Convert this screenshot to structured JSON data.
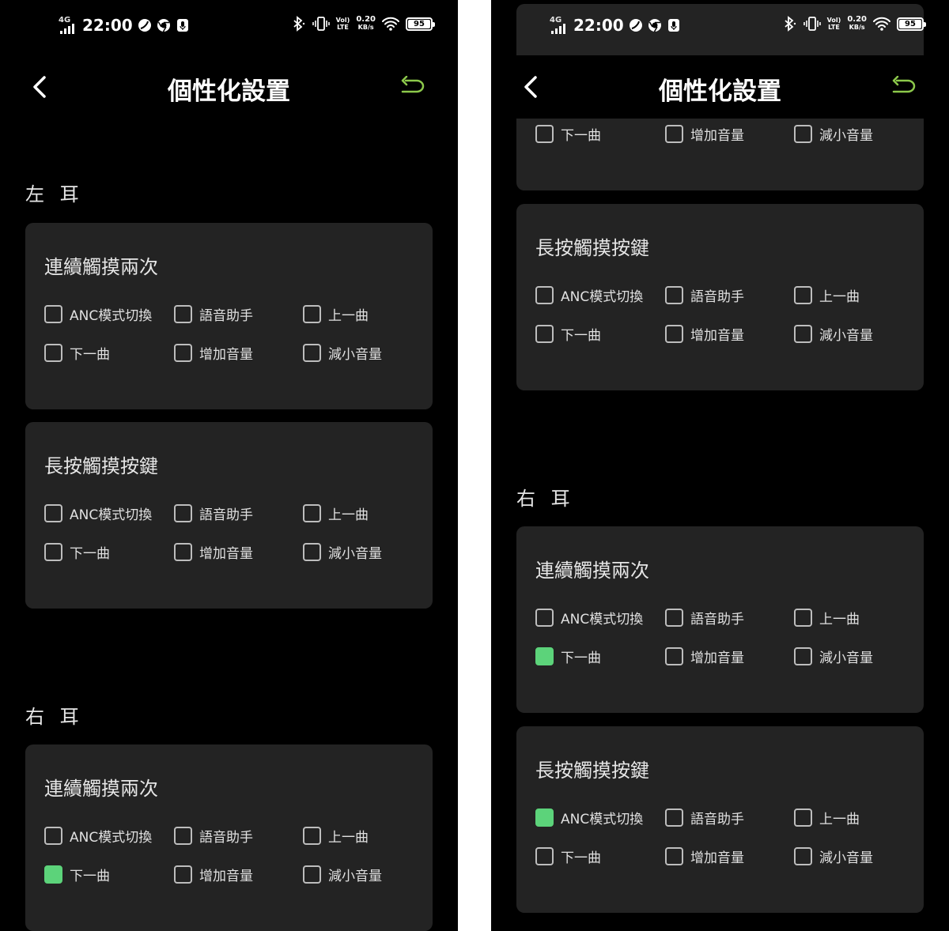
{
  "status_bar": {
    "network": "4G",
    "time": "22:00",
    "speed_value": "0.20",
    "speed_unit": "KB/s",
    "volte_top": "Vol)",
    "volte_bottom": "LTE",
    "battery": "95"
  },
  "header": {
    "title": "個性化設置",
    "back_icon": "chevron-left-icon",
    "reset_icon": "undo-arrow-icon",
    "accent_color": "#8cc84b"
  },
  "option_labels": [
    "ANC模式切換",
    "語音助手",
    "上一曲",
    "下一曲",
    "增加音量",
    "減小音量"
  ],
  "checked_color": "#5cd37a",
  "left_screen": {
    "sections": [
      {
        "title": "左 耳",
        "cards": [
          {
            "title": "連續觸摸兩次",
            "checked": [
              false,
              false,
              false,
              false,
              false,
              false
            ]
          },
          {
            "title": "長按觸摸按鍵",
            "checked": [
              false,
              false,
              false,
              false,
              false,
              false
            ]
          }
        ]
      },
      {
        "title": "右 耳",
        "cards": [
          {
            "title": "連續觸摸兩次",
            "checked": [
              false,
              false,
              false,
              true,
              false,
              false
            ]
          }
        ]
      }
    ]
  },
  "right_screen": {
    "partial_card": {
      "checked": [
        false,
        false,
        false
      ]
    },
    "left_card": {
      "title": "長按觸摸按鍵",
      "checked": [
        false,
        false,
        false,
        false,
        false,
        false
      ]
    },
    "sections": [
      {
        "title": "右 耳",
        "cards": [
          {
            "title": "連續觸摸兩次",
            "checked": [
              false,
              false,
              false,
              true,
              false,
              false
            ]
          },
          {
            "title": "長按觸摸按鍵",
            "checked": [
              true,
              false,
              false,
              false,
              false,
              false
            ]
          }
        ]
      }
    ]
  }
}
